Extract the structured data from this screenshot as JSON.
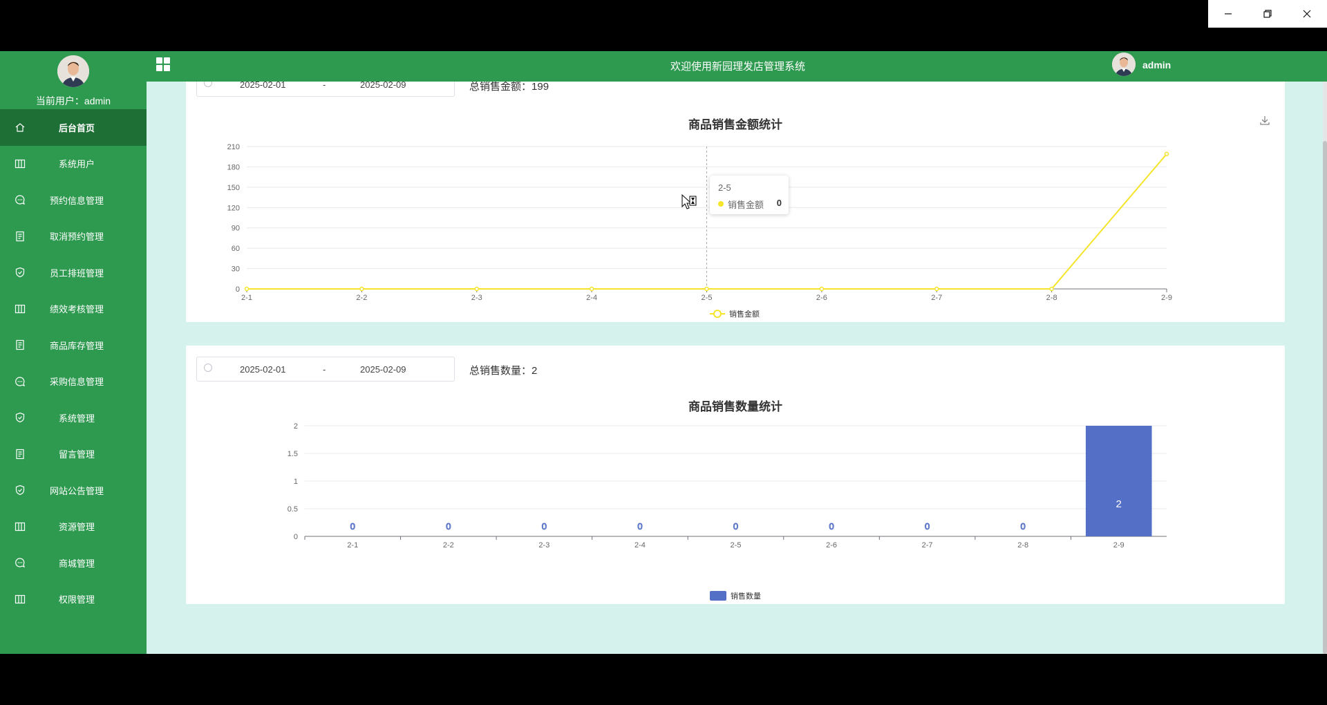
{
  "window": {
    "controls": [
      "minimize-icon",
      "restore-icon",
      "close-icon"
    ]
  },
  "header": {
    "title": "欢迎使用新园理发店管理系统",
    "user": "admin"
  },
  "sidebar": {
    "current_user_label": "当前用户：",
    "current_user": "admin",
    "items": [
      {
        "label": "后台首页",
        "icon": "home-icon",
        "active": true
      },
      {
        "label": "系统用户",
        "icon": "table-icon"
      },
      {
        "label": "预约信息管理",
        "icon": "chat-icon"
      },
      {
        "label": "取消预约管理",
        "icon": "document-icon"
      },
      {
        "label": "员工排班管理",
        "icon": "shield-check-icon"
      },
      {
        "label": "绩效考核管理",
        "icon": "table-icon"
      },
      {
        "label": "商品库存管理",
        "icon": "document-icon"
      },
      {
        "label": "采购信息管理",
        "icon": "chat-icon"
      },
      {
        "label": "系统管理",
        "icon": "shield-check-icon"
      },
      {
        "label": "留言管理",
        "icon": "document-icon"
      },
      {
        "label": "网站公告管理",
        "icon": "shield-check-icon"
      },
      {
        "label": "资源管理",
        "icon": "table-icon"
      },
      {
        "label": "商城管理",
        "icon": "chat-icon"
      },
      {
        "label": "权限管理",
        "icon": "table-icon"
      }
    ]
  },
  "sales_amount": {
    "date_start": "2025-02-01",
    "date_separator": "-",
    "date_end": "2025-02-09",
    "total_label": "总销售金额：",
    "total_value": "199",
    "tooltip": {
      "date": "2-5",
      "series": "销售金额",
      "value": "0"
    }
  },
  "sales_quantity": {
    "date_start": "2025-02-01",
    "date_separator": "-",
    "date_end": "2025-02-09",
    "total_label": "总销售数量：",
    "total_value": "2"
  },
  "colors": {
    "sidebar": "#2e9a50",
    "sidebar_active": "#1e6f35",
    "content_bg": "#d5f3ec",
    "line": "#f5e52a",
    "bar": "#5470c6"
  },
  "chart_data": [
    {
      "type": "line",
      "title": "商品销售金额统计",
      "categories": [
        "2-1",
        "2-2",
        "2-3",
        "2-4",
        "2-5",
        "2-6",
        "2-7",
        "2-8",
        "2-9"
      ],
      "series": [
        {
          "name": "销售金额",
          "values": [
            0,
            0,
            0,
            0,
            0,
            0,
            0,
            0,
            199
          ]
        }
      ],
      "ylim": [
        0,
        210
      ],
      "yticks": [
        0,
        30,
        60,
        90,
        120,
        150,
        180,
        210
      ],
      "grid": true,
      "legend": "bottom-center",
      "toolbox": "download-icon"
    },
    {
      "type": "bar",
      "title": "商品销售数量统计",
      "categories": [
        "2-1",
        "2-2",
        "2-3",
        "2-4",
        "2-5",
        "2-6",
        "2-7",
        "2-8",
        "2-9"
      ],
      "series": [
        {
          "name": "销售数量",
          "values": [
            0,
            0,
            0,
            0,
            0,
            0,
            0,
            0,
            2
          ]
        }
      ],
      "ylim": [
        0,
        2
      ],
      "yticks": [
        "0",
        "0.5",
        "1",
        "1.5",
        "2"
      ],
      "grid": true,
      "legend": "bottom-center",
      "data_labels": true
    }
  ]
}
